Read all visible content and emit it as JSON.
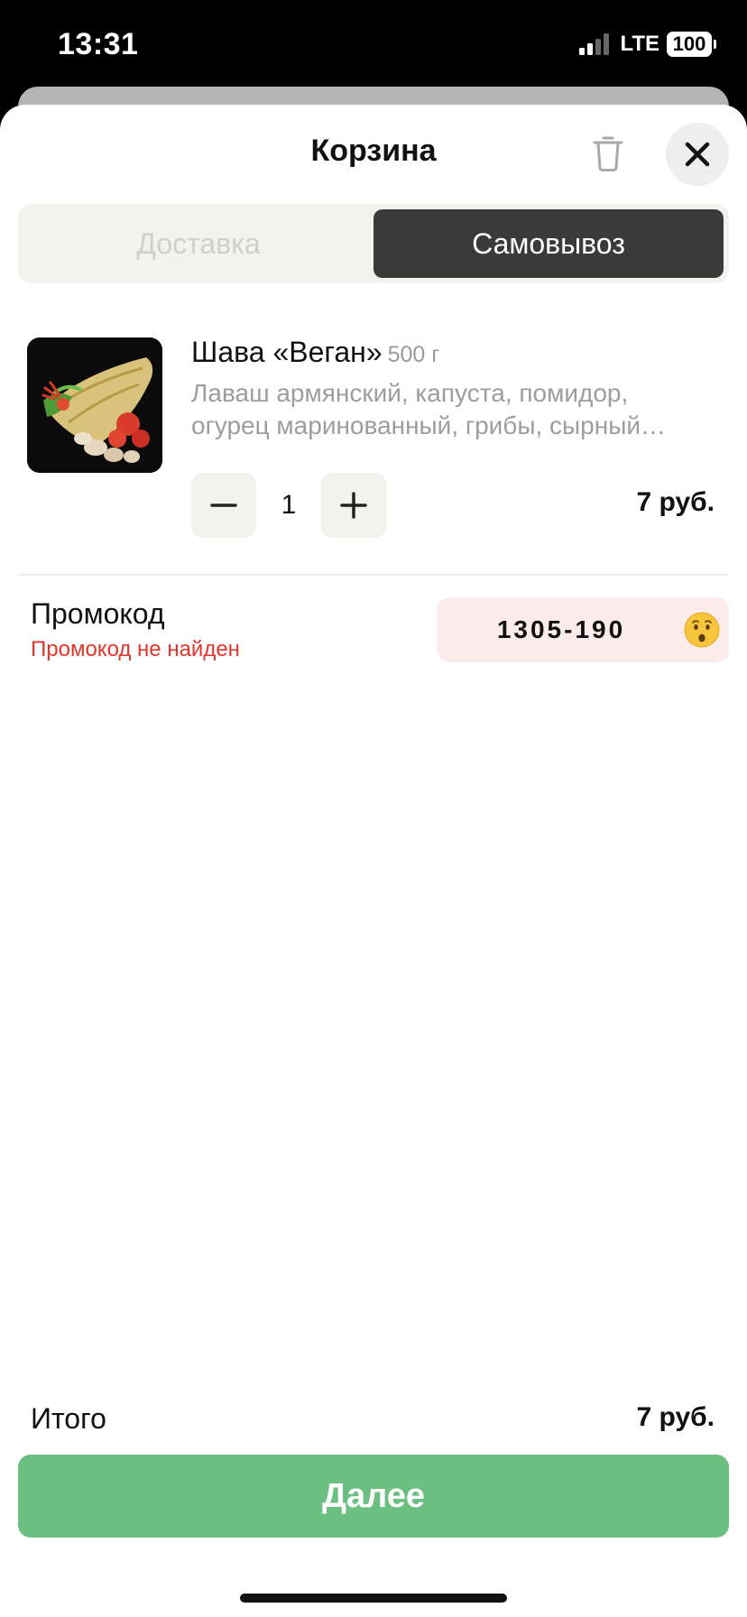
{
  "status_bar": {
    "time": "13:31",
    "network": "LTE",
    "battery": "100"
  },
  "sheet": {
    "title": "Корзина",
    "icons": {
      "trash": "trash-icon",
      "close": "close-icon"
    }
  },
  "tabs": [
    {
      "label": "Доставка",
      "selected": false
    },
    {
      "label": "Самовывоз",
      "selected": true
    }
  ],
  "cart": {
    "items": [
      {
        "name": "Шава «Веган»",
        "weight": "500 г",
        "description": "Лаваш армянский, капуста, помидор, огурец маринованный, грибы, сырный…",
        "quantity": "1",
        "price": "7 руб."
      }
    ]
  },
  "promo": {
    "label": "Промокод",
    "error": "Промокод не найден",
    "code": "1305-190",
    "status_icon": "hushed-face-emoji"
  },
  "footer": {
    "total_label": "Итого",
    "total_value": "7 руб.",
    "next_label": "Далее"
  },
  "colors": {
    "accent_green": "#6abf81",
    "error_red": "#e0362c",
    "selected_tab": "#3a3a3a",
    "promo_bg": "#fbeceb"
  }
}
